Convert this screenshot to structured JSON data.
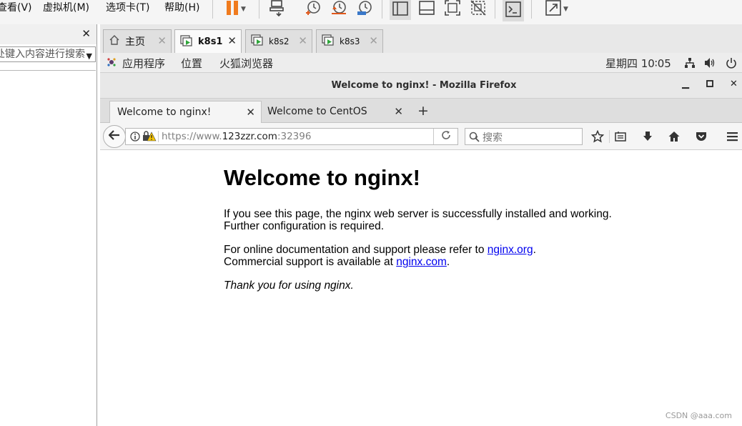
{
  "vmware": {
    "menu": [
      {
        "label": "查看(V)",
        "x": -16
      },
      {
        "label": "虚拟机(M)"
      },
      {
        "label": "选项卡(T)"
      },
      {
        "label": "帮助(H)"
      }
    ],
    "library": {
      "search_placeholder": "在此处键入内容进行搜索"
    },
    "vm_tabs": [
      {
        "label": "主页",
        "icon": "home-icon",
        "active": false
      },
      {
        "label": "k8s1",
        "icon": "vm-running-icon",
        "active": true
      },
      {
        "label": "k8s2",
        "icon": "vm-running-icon",
        "active": false
      },
      {
        "label": "k8s3",
        "icon": "vm-running-icon",
        "active": false
      }
    ]
  },
  "gnome": {
    "applications": "应用程序",
    "places": "位置",
    "firefox": "火狐浏览器",
    "clock": "星期四 10∶05"
  },
  "firefox": {
    "window_title": "Welcome to nginx! - Mozilla Firefox",
    "tabs": [
      {
        "title": "Welcome to nginx!",
        "active": true
      },
      {
        "title": "Welcome to CentOS",
        "active": false
      }
    ],
    "url": {
      "prefix": "https://www.",
      "domain": "123zzr.com",
      "suffix": ":32396"
    },
    "search_placeholder": "搜索"
  },
  "page": {
    "heading": "Welcome to nginx!",
    "para1_line1": "If you see this page, the nginx web server is successfully installed and working.",
    "para1_line2": "Further configuration is required.",
    "para2_line1_prefix": "For online documentation and support please refer to ",
    "para2_link1": "nginx.org",
    "para2_line1_suffix": ".",
    "para2_line2_prefix": "Commercial support is available at ",
    "para2_link2": "nginx.com",
    "para2_line2_suffix": ".",
    "para3": "Thank you for using nginx."
  },
  "watermark": "CSDN @aaa.com",
  "colors": {
    "pause_orange": "#f07b1e",
    "link_blue": "#0000ee",
    "vm_play_green": "#2fa63a"
  }
}
